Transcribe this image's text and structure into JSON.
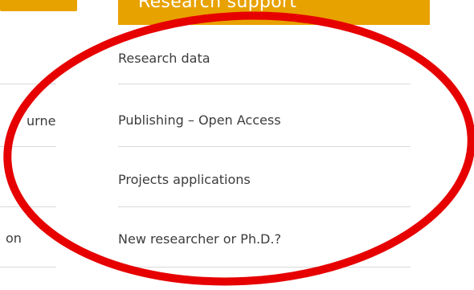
{
  "right_column": {
    "header": "Research support",
    "items": [
      {
        "label": "Research data"
      },
      {
        "label": "Publishing – Open Access"
      },
      {
        "label": "Projects applications"
      },
      {
        "label": "New researcher or Ph.D.?"
      }
    ]
  },
  "left_column": {
    "items": [
      {
        "label": "urney"
      },
      {
        "label": "on"
      }
    ]
  },
  "colors": {
    "header_bg": "#e8a200",
    "header_text": "#ffffff",
    "item_text": "#3c3c3c",
    "divider": "#d9d9d9",
    "annotation": "#e60000"
  },
  "annotation": {
    "shape": "ellipse",
    "meaning": "highlight"
  }
}
